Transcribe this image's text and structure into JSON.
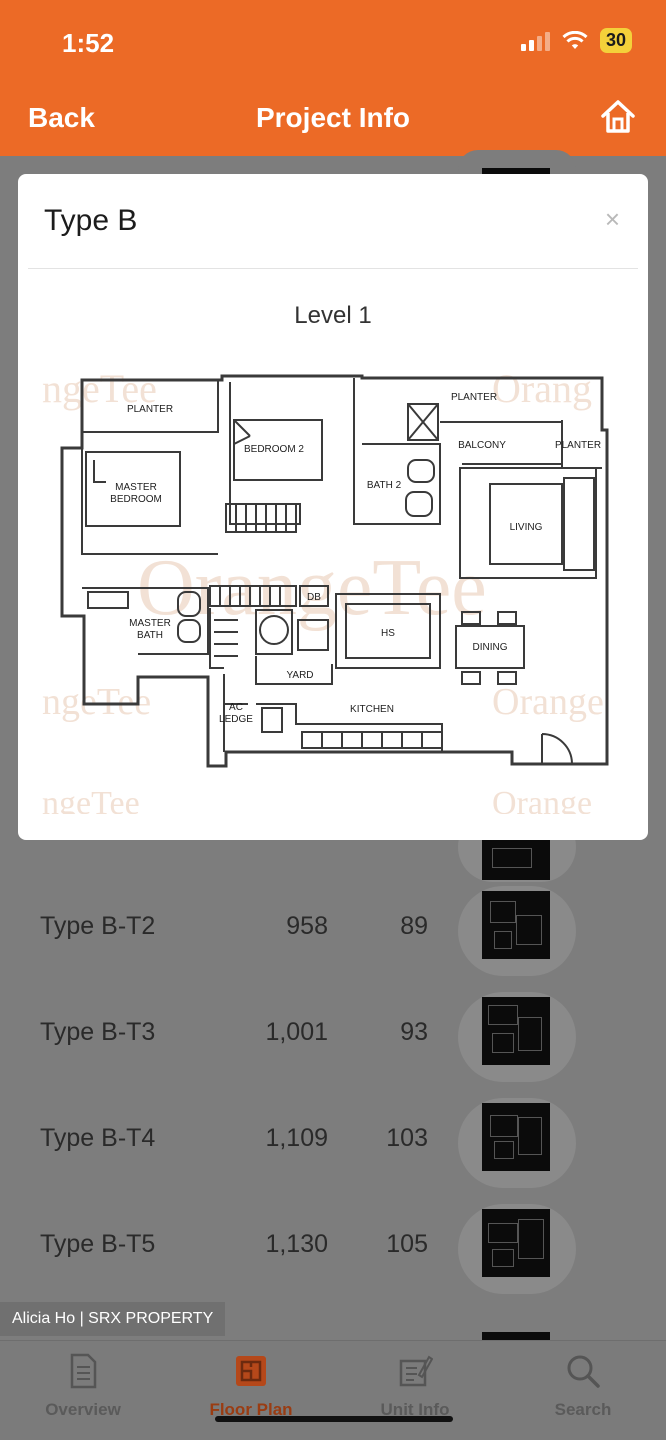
{
  "status_bar": {
    "time": "1:52",
    "battery": "30"
  },
  "nav": {
    "back_label": "Back",
    "title": "Project Info",
    "home_icon": "home-icon"
  },
  "modal": {
    "title": "Type B",
    "close_label": "×",
    "level": "Level 1",
    "plan_labels": {
      "planter_left": "PLANTER",
      "planter_right": "PLANTER",
      "planter_far": "PLANTER",
      "bedroom2": "BEDROOM 2",
      "bath2": "BATH 2",
      "balcony": "BALCONY",
      "master_bedroom_1": "MASTER",
      "master_bedroom_2": "BEDROOM",
      "living": "LIVING",
      "master_bath_1": "MASTER",
      "master_bath_2": "BATH",
      "db": "DB",
      "hs": "HS",
      "dining": "DINING",
      "yard": "YARD",
      "kitchen": "KITCHEN",
      "ac_1": "AC",
      "ac_2": "LEDGE"
    },
    "watermark": "OrangeTee"
  },
  "units": [
    {
      "name": "Type B-T2",
      "sqft": "958",
      "sqm": "89"
    },
    {
      "name": "Type B-T3",
      "sqft": "1,001",
      "sqm": "93"
    },
    {
      "name": "Type B-T4",
      "sqft": "1,109",
      "sqm": "103"
    },
    {
      "name": "Type B-T5",
      "sqft": "1,130",
      "sqm": "105"
    }
  ],
  "agent_tag": "Alicia Ho | SRX PROPERTY",
  "tabs": [
    {
      "label": "Overview",
      "icon": "document-icon",
      "active": false
    },
    {
      "label": "Floor Plan",
      "icon": "floor-plan-icon",
      "active": true
    },
    {
      "label": "Unit Info",
      "icon": "unit-info-icon",
      "active": false
    },
    {
      "label": "Search",
      "icon": "search-icon",
      "active": false
    }
  ],
  "colors": {
    "brand_orange": "#ec6a26",
    "overlay_gray": "#7d7d7d"
  }
}
